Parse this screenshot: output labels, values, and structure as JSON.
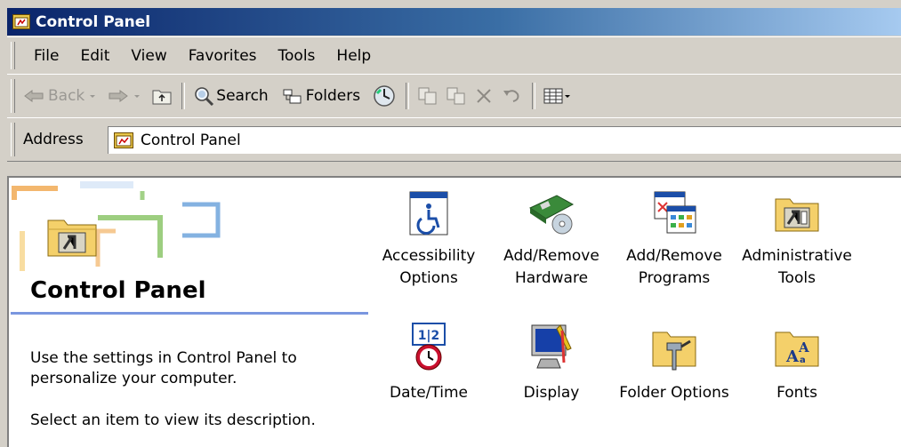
{
  "window": {
    "title": "Control Panel"
  },
  "menu": [
    "File",
    "Edit",
    "View",
    "Favorites",
    "Tools",
    "Help"
  ],
  "toolbar": {
    "back": "Back",
    "search": "Search",
    "folders": "Folders"
  },
  "address": {
    "label": "Address",
    "value": "Control Panel"
  },
  "left_pane": {
    "title": "Control Panel",
    "description": "Use the settings in Control Panel to personalize your computer.",
    "hint": "Select an item to view its description."
  },
  "items": [
    {
      "label": "Accessibility Options",
      "icon": "accessibility-icon"
    },
    {
      "label": "Add/Remove Hardware",
      "icon": "hardware-icon"
    },
    {
      "label": "Add/Remove Programs",
      "icon": "programs-icon"
    },
    {
      "label": "Administrative Tools",
      "icon": "admin-tools-icon"
    },
    {
      "label": "Date/Time",
      "icon": "datetime-icon"
    },
    {
      "label": "Display",
      "icon": "display-icon"
    },
    {
      "label": "Folder Options",
      "icon": "folder-options-icon"
    },
    {
      "label": "Fonts",
      "icon": "fonts-icon"
    }
  ],
  "colors": {
    "titlebar_start": "#0a246a",
    "titlebar_end": "#a6caf0",
    "chrome": "#d4d0c8",
    "pane_accent": "#7a96df"
  }
}
